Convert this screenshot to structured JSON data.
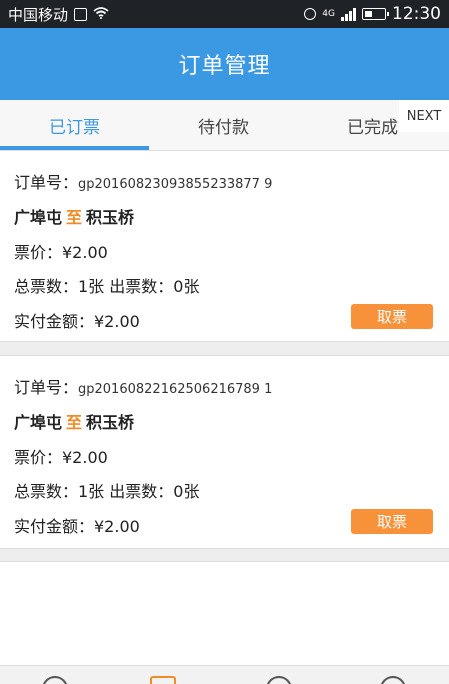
{
  "status_bar": {
    "carrier": "中国移动",
    "network": "4G",
    "time": "12:30",
    "icons": [
      "sim-icon",
      "wifi-icon",
      "alarm-icon",
      "signal-icon",
      "battery-icon"
    ]
  },
  "app_bar": {
    "title": "订单管理"
  },
  "tabs": [
    {
      "label": "已订票",
      "active": true
    },
    {
      "label": "待付款",
      "active": false
    },
    {
      "label": "已完成",
      "active": false
    }
  ],
  "next_label": "NEXT",
  "orders": [
    {
      "order_label": "订单号：",
      "order_no": "gp20160823093855233877 9",
      "from": "广埠屯",
      "to_word": "至",
      "to": "积玉桥",
      "price_text": "票价：¥2.00",
      "count_text": "总票数：1张  出票数：0张",
      "paid_text": "实付金额：¥2.00",
      "button_label": "取票"
    },
    {
      "order_label": "订单号：",
      "order_no": "gp20160822162506216789 1",
      "from": "广埠屯",
      "to_word": "至",
      "to": "积玉桥",
      "price_text": "票价：¥2.00",
      "count_text": "总票数：1张  出票数：0张",
      "paid_text": "实付金额：¥2.00",
      "button_label": "取票"
    }
  ],
  "colors": {
    "primary": "#3b99e3",
    "accent": "#f08c28",
    "button": "#f7923a",
    "status_bar": "#1f2226"
  }
}
